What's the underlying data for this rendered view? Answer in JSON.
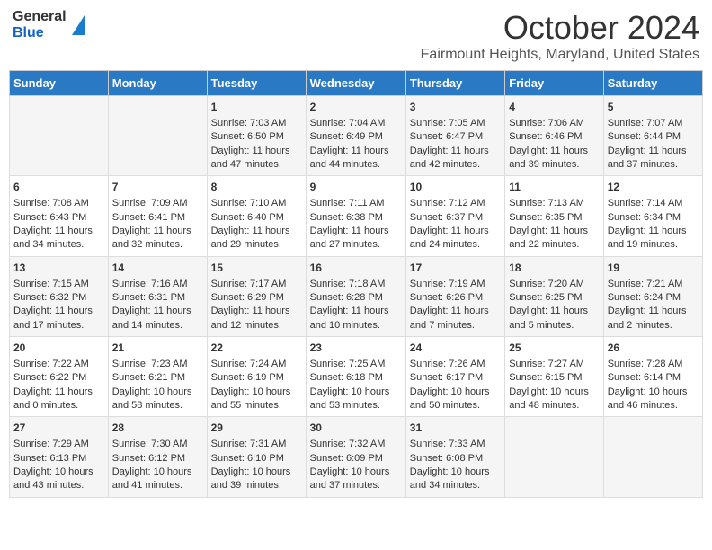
{
  "header": {
    "logo": {
      "general": "General",
      "blue": "Blue"
    },
    "title": "October 2024",
    "location": "Fairmount Heights, Maryland, United States"
  },
  "weekdays": [
    "Sunday",
    "Monday",
    "Tuesday",
    "Wednesday",
    "Thursday",
    "Friday",
    "Saturday"
  ],
  "weeks": [
    [
      {
        "day": "",
        "sunrise": "",
        "sunset": "",
        "daylight": ""
      },
      {
        "day": "",
        "sunrise": "",
        "sunset": "",
        "daylight": ""
      },
      {
        "day": "1",
        "sunrise": "Sunrise: 7:03 AM",
        "sunset": "Sunset: 6:50 PM",
        "daylight": "Daylight: 11 hours and 47 minutes."
      },
      {
        "day": "2",
        "sunrise": "Sunrise: 7:04 AM",
        "sunset": "Sunset: 6:49 PM",
        "daylight": "Daylight: 11 hours and 44 minutes."
      },
      {
        "day": "3",
        "sunrise": "Sunrise: 7:05 AM",
        "sunset": "Sunset: 6:47 PM",
        "daylight": "Daylight: 11 hours and 42 minutes."
      },
      {
        "day": "4",
        "sunrise": "Sunrise: 7:06 AM",
        "sunset": "Sunset: 6:46 PM",
        "daylight": "Daylight: 11 hours and 39 minutes."
      },
      {
        "day": "5",
        "sunrise": "Sunrise: 7:07 AM",
        "sunset": "Sunset: 6:44 PM",
        "daylight": "Daylight: 11 hours and 37 minutes."
      }
    ],
    [
      {
        "day": "6",
        "sunrise": "Sunrise: 7:08 AM",
        "sunset": "Sunset: 6:43 PM",
        "daylight": "Daylight: 11 hours and 34 minutes."
      },
      {
        "day": "7",
        "sunrise": "Sunrise: 7:09 AM",
        "sunset": "Sunset: 6:41 PM",
        "daylight": "Daylight: 11 hours and 32 minutes."
      },
      {
        "day": "8",
        "sunrise": "Sunrise: 7:10 AM",
        "sunset": "Sunset: 6:40 PM",
        "daylight": "Daylight: 11 hours and 29 minutes."
      },
      {
        "day": "9",
        "sunrise": "Sunrise: 7:11 AM",
        "sunset": "Sunset: 6:38 PM",
        "daylight": "Daylight: 11 hours and 27 minutes."
      },
      {
        "day": "10",
        "sunrise": "Sunrise: 7:12 AM",
        "sunset": "Sunset: 6:37 PM",
        "daylight": "Daylight: 11 hours and 24 minutes."
      },
      {
        "day": "11",
        "sunrise": "Sunrise: 7:13 AM",
        "sunset": "Sunset: 6:35 PM",
        "daylight": "Daylight: 11 hours and 22 minutes."
      },
      {
        "day": "12",
        "sunrise": "Sunrise: 7:14 AM",
        "sunset": "Sunset: 6:34 PM",
        "daylight": "Daylight: 11 hours and 19 minutes."
      }
    ],
    [
      {
        "day": "13",
        "sunrise": "Sunrise: 7:15 AM",
        "sunset": "Sunset: 6:32 PM",
        "daylight": "Daylight: 11 hours and 17 minutes."
      },
      {
        "day": "14",
        "sunrise": "Sunrise: 7:16 AM",
        "sunset": "Sunset: 6:31 PM",
        "daylight": "Daylight: 11 hours and 14 minutes."
      },
      {
        "day": "15",
        "sunrise": "Sunrise: 7:17 AM",
        "sunset": "Sunset: 6:29 PM",
        "daylight": "Daylight: 11 hours and 12 minutes."
      },
      {
        "day": "16",
        "sunrise": "Sunrise: 7:18 AM",
        "sunset": "Sunset: 6:28 PM",
        "daylight": "Daylight: 11 hours and 10 minutes."
      },
      {
        "day": "17",
        "sunrise": "Sunrise: 7:19 AM",
        "sunset": "Sunset: 6:26 PM",
        "daylight": "Daylight: 11 hours and 7 minutes."
      },
      {
        "day": "18",
        "sunrise": "Sunrise: 7:20 AM",
        "sunset": "Sunset: 6:25 PM",
        "daylight": "Daylight: 11 hours and 5 minutes."
      },
      {
        "day": "19",
        "sunrise": "Sunrise: 7:21 AM",
        "sunset": "Sunset: 6:24 PM",
        "daylight": "Daylight: 11 hours and 2 minutes."
      }
    ],
    [
      {
        "day": "20",
        "sunrise": "Sunrise: 7:22 AM",
        "sunset": "Sunset: 6:22 PM",
        "daylight": "Daylight: 11 hours and 0 minutes."
      },
      {
        "day": "21",
        "sunrise": "Sunrise: 7:23 AM",
        "sunset": "Sunset: 6:21 PM",
        "daylight": "Daylight: 10 hours and 58 minutes."
      },
      {
        "day": "22",
        "sunrise": "Sunrise: 7:24 AM",
        "sunset": "Sunset: 6:19 PM",
        "daylight": "Daylight: 10 hours and 55 minutes."
      },
      {
        "day": "23",
        "sunrise": "Sunrise: 7:25 AM",
        "sunset": "Sunset: 6:18 PM",
        "daylight": "Daylight: 10 hours and 53 minutes."
      },
      {
        "day": "24",
        "sunrise": "Sunrise: 7:26 AM",
        "sunset": "Sunset: 6:17 PM",
        "daylight": "Daylight: 10 hours and 50 minutes."
      },
      {
        "day": "25",
        "sunrise": "Sunrise: 7:27 AM",
        "sunset": "Sunset: 6:15 PM",
        "daylight": "Daylight: 10 hours and 48 minutes."
      },
      {
        "day": "26",
        "sunrise": "Sunrise: 7:28 AM",
        "sunset": "Sunset: 6:14 PM",
        "daylight": "Daylight: 10 hours and 46 minutes."
      }
    ],
    [
      {
        "day": "27",
        "sunrise": "Sunrise: 7:29 AM",
        "sunset": "Sunset: 6:13 PM",
        "daylight": "Daylight: 10 hours and 43 minutes."
      },
      {
        "day": "28",
        "sunrise": "Sunrise: 7:30 AM",
        "sunset": "Sunset: 6:12 PM",
        "daylight": "Daylight: 10 hours and 41 minutes."
      },
      {
        "day": "29",
        "sunrise": "Sunrise: 7:31 AM",
        "sunset": "Sunset: 6:10 PM",
        "daylight": "Daylight: 10 hours and 39 minutes."
      },
      {
        "day": "30",
        "sunrise": "Sunrise: 7:32 AM",
        "sunset": "Sunset: 6:09 PM",
        "daylight": "Daylight: 10 hours and 37 minutes."
      },
      {
        "day": "31",
        "sunrise": "Sunrise: 7:33 AM",
        "sunset": "Sunset: 6:08 PM",
        "daylight": "Daylight: 10 hours and 34 minutes."
      },
      {
        "day": "",
        "sunrise": "",
        "sunset": "",
        "daylight": ""
      },
      {
        "day": "",
        "sunrise": "",
        "sunset": "",
        "daylight": ""
      }
    ]
  ]
}
